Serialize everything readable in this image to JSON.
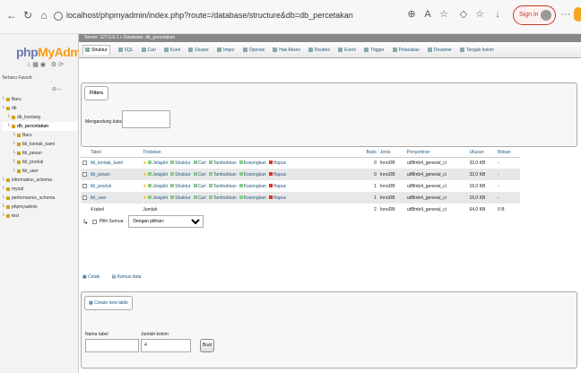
{
  "browser": {
    "url": "localhost/phpmyadmin/index.php?route=/database/structure&db=db_percetakan",
    "signin_label": "Sign in"
  },
  "sidebar": {
    "logo_a": "php",
    "logo_b": "MyAdmin",
    "recent": "Terbaru  Favorit",
    "tree": [
      {
        "label": "Baru",
        "indent": 0
      },
      {
        "label": "db",
        "indent": 0
      },
      {
        "label": "db_kontang",
        "indent": 1
      },
      {
        "label": "db_percetakan",
        "indent": 1,
        "selected": true
      },
      {
        "label": "Baru",
        "indent": 2
      },
      {
        "label": "tbl_kontak_kami",
        "indent": 2
      },
      {
        "label": "tbl_pesan",
        "indent": 2
      },
      {
        "label": "tbl_produk",
        "indent": 2
      },
      {
        "label": "tbl_user",
        "indent": 2
      },
      {
        "label": "information_schema",
        "indent": 0
      },
      {
        "label": "mysql",
        "indent": 0
      },
      {
        "label": "performance_schema",
        "indent": 0
      },
      {
        "label": "phpmyadmin",
        "indent": 0
      },
      {
        "label": "test",
        "indent": 0
      }
    ]
  },
  "breadcrumb": "Server: 127.0.0.1 » Database: db_percetakan",
  "tabs": [
    "Struktur",
    "SQL",
    "Cari",
    "Kueri",
    "Ekspor",
    "Impor",
    "Operasi",
    "Hak Akses",
    "Routine",
    "Event",
    "Trigger",
    "Pelacakan",
    "Desainer",
    "Tengah kolom"
  ],
  "filter": {
    "legend": "Filters",
    "label": "Mengandung kata:"
  },
  "table": {
    "headers": [
      "Tabel",
      "Tindakan",
      "Baris",
      "Jenis",
      "Penyortiran",
      "Ukuran",
      "Beban"
    ],
    "actions": [
      "Jelajahi",
      "Struktur",
      "Cari",
      "Tambahkan",
      "Kosongkan",
      "Hapus"
    ],
    "rows": [
      {
        "name": "tbl_kontak_kami",
        "rows": "0",
        "type": "InnoDB",
        "collation": "utf8mb4_general_ci",
        "size": "32,0 KB",
        "overhead": "-"
      },
      {
        "name": "tbl_pesan",
        "rows": "0",
        "type": "InnoDB",
        "collation": "utf8mb4_general_ci",
        "size": "32,0 KB",
        "overhead": "-"
      },
      {
        "name": "tbl_produk",
        "rows": "1",
        "type": "InnoDB",
        "collation": "utf8mb4_general_ci",
        "size": "16,0 KB",
        "overhead": "-"
      },
      {
        "name": "tbl_user",
        "rows": "1",
        "type": "InnoDB",
        "collation": "utf8mb4_general_ci",
        "size": "16,0 KB",
        "overhead": "-"
      }
    ],
    "summary": {
      "name": "4 tabel",
      "label": "Jumlah",
      "rows": "2",
      "type": "InnoDB",
      "collation": "utf8mb4_general_ci",
      "size": "64,0 KB",
      "overhead": "0 B"
    }
  },
  "bulk": {
    "check_all": "Pilih Semua",
    "with_selected": "Dengan pilihan:"
  },
  "print_row": {
    "print": "Cetak",
    "dictionary": "Kamus data"
  },
  "create": {
    "legend": "Create new table",
    "name_label": "Nama tabel",
    "cols_label": "Jumlah kolom",
    "cols_value": "4",
    "go_label": "Buat"
  }
}
